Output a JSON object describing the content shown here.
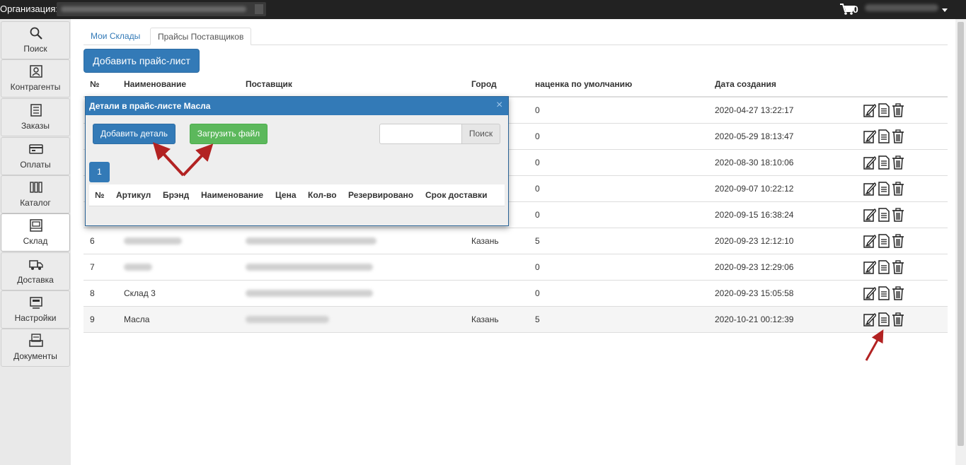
{
  "topbar": {
    "org_label": "Организация:",
    "cart_count": "0"
  },
  "sidebar": {
    "items": [
      {
        "label": "Поиск",
        "icon": "search-icon"
      },
      {
        "label": "Контрагенты",
        "icon": "contacts-icon"
      },
      {
        "label": "Заказы",
        "icon": "orders-icon"
      },
      {
        "label": "Оплаты",
        "icon": "payments-icon"
      },
      {
        "label": "Каталог",
        "icon": "catalog-icon"
      },
      {
        "label": "Склад",
        "icon": "warehouse-icon",
        "active": true
      },
      {
        "label": "Доставка",
        "icon": "delivery-icon"
      },
      {
        "label": "Настройки",
        "icon": "settings-icon"
      },
      {
        "label": "Документы",
        "icon": "documents-icon"
      }
    ]
  },
  "tabs": [
    {
      "label": "Мои Склады",
      "active": false
    },
    {
      "label": "Прайсы Поставщиков",
      "active": true
    }
  ],
  "add_price_label": "Добавить прайс-лист",
  "table": {
    "headers": {
      "num": "№",
      "name": "Наименование",
      "supplier": "Поставщик",
      "city": "Город",
      "markup": "наценка по умолчанию",
      "created": "Дата создания"
    },
    "rows": [
      {
        "num": "",
        "name": "",
        "city": "",
        "markup": "0",
        "created": "2020-04-27 13:22:17"
      },
      {
        "num": "",
        "name": "",
        "city": "",
        "markup": "0",
        "created": "2020-05-29 18:13:47"
      },
      {
        "num": "",
        "name": "",
        "city": "",
        "markup": "0",
        "created": "2020-08-30 18:10:06"
      },
      {
        "num": "",
        "name": "",
        "city": "",
        "markup": "0",
        "created": "2020-09-07 10:22:12"
      },
      {
        "num": "",
        "name": "",
        "city": "",
        "markup": "0",
        "created": "2020-09-15 16:38:24"
      },
      {
        "num": "6",
        "name": "",
        "city": "Казань",
        "markup": "5",
        "created": "2020-09-23 12:12:10"
      },
      {
        "num": "7",
        "name": "",
        "city": "",
        "markup": "0",
        "created": "2020-09-23 12:29:06"
      },
      {
        "num": "8",
        "name": "Склад 3",
        "city": "",
        "markup": "0",
        "created": "2020-09-23 15:05:58"
      },
      {
        "num": "9",
        "name": "Масла",
        "city": "Казань",
        "markup": "5",
        "created": "2020-10-21 00:12:39"
      }
    ]
  },
  "modal": {
    "title": "Детали в прайс-листе Масла",
    "close": "×",
    "add_detail_label": "Добавить деталь",
    "upload_label": "Загрузить файл",
    "search_placeholder": "",
    "search_button": "Поиск",
    "page": "1",
    "columns": [
      "№",
      "Артикул",
      "Брэнд",
      "Наименование",
      "Цена",
      "Кол-во",
      "Резервировано",
      "Срок доставки"
    ]
  },
  "colors": {
    "primary": "#337ab7",
    "success": "#5cb85c",
    "annotation_arrow": "#b22222"
  }
}
